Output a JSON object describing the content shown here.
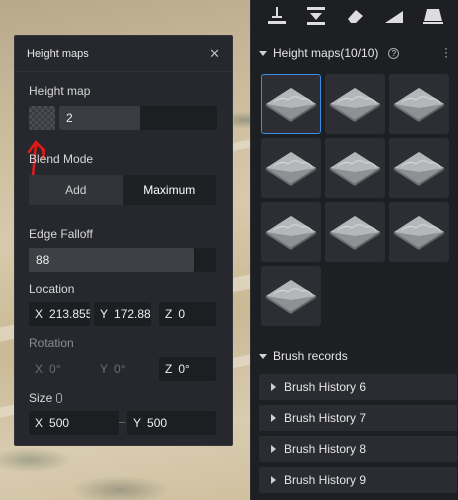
{
  "panel": {
    "title": "Height maps",
    "close_icon": "close-icon",
    "height_map_label": "Height map",
    "height_map_value": "2",
    "blend_mode_label": "Blend Mode",
    "blend_options": [
      "Add",
      "Maximum"
    ],
    "blend_selected": "Maximum",
    "edge_falloff_label": "Edge Falloff",
    "edge_falloff_value": "88",
    "edge_falloff_fraction": 0.88,
    "location_label": "Location",
    "location": {
      "x": "213.855",
      "y": "172.88",
      "z": "0"
    },
    "rotation_label": "Rotation",
    "rotation": {
      "x": "0°",
      "y": "0°",
      "z": "0°"
    },
    "size_label": "Size",
    "size": {
      "x": "500",
      "y": "500"
    },
    "axis": {
      "x": "X",
      "y": "Y",
      "z": "Z"
    }
  },
  "dock": {
    "heightmaps_title": "Height maps(10/10)",
    "heightmap_count": 10,
    "selected_index": 0,
    "brush_records_title": "Brush records",
    "brush_history": [
      "Brush History 6",
      "Brush History 7",
      "Brush History 8",
      "Brush History 9"
    ]
  },
  "colors": {
    "accent": "#3a8ee6",
    "annotation": "#e11a1a"
  }
}
